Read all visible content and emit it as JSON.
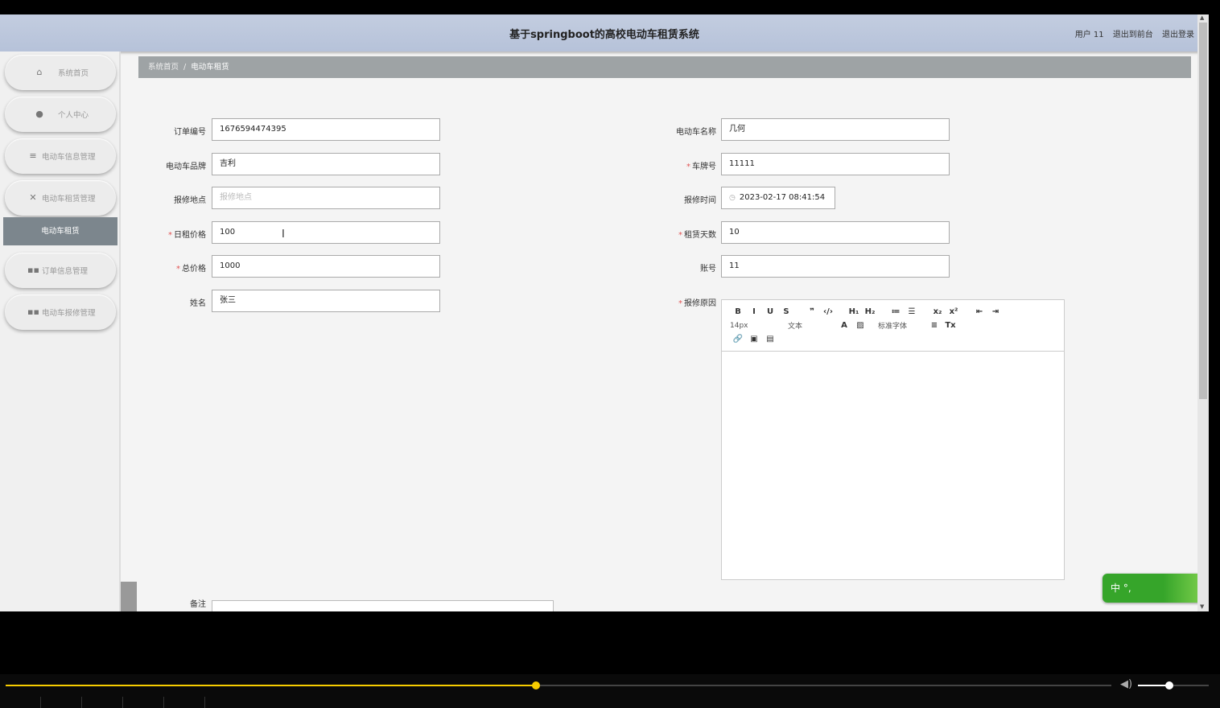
{
  "header": {
    "title": "基于springboot的高校电动车租赁系统",
    "user": "用户 11",
    "to_front": "退出到前台",
    "logout": "退出登录"
  },
  "sidebar": {
    "items": [
      {
        "label": "系统首页",
        "icon": "home-icon"
      },
      {
        "label": "个人中心",
        "icon": "user-icon"
      },
      {
        "label": "电动车信息管理",
        "icon": "list-icon"
      },
      {
        "label": "电动车租赁管理",
        "icon": "bike-icon"
      },
      {
        "label": "订单信息管理",
        "icon": "grid-icon"
      },
      {
        "label": "电动车报修管理",
        "icon": "grid-icon"
      }
    ],
    "active_sub": "电动车租赁"
  },
  "breadcrumb": {
    "home": "系统首页",
    "sep": "/",
    "current": "电动车租赁"
  },
  "form": {
    "order_no": {
      "label": "订单编号",
      "value": "1676594474395"
    },
    "brand": {
      "label": "电动车品牌",
      "value": "吉利"
    },
    "repair_place": {
      "label": "报修地点",
      "placeholder": "报修地点"
    },
    "daily_price": {
      "label": "日租价格",
      "value": "100",
      "required": "*"
    },
    "total_price": {
      "label": "总价格",
      "value": "1000",
      "required": "*"
    },
    "name": {
      "label": "姓名",
      "value": "张三"
    },
    "bike_name": {
      "label": "电动车名称",
      "value": "几何"
    },
    "plate": {
      "label": "车牌号",
      "value": "11111",
      "required": "*"
    },
    "repair_time": {
      "label": "报修时间",
      "value": "2023-02-17 08:41:54"
    },
    "rent_days": {
      "label": "租赁天数",
      "value": "10",
      "required": "*"
    },
    "account": {
      "label": "账号",
      "value": "11"
    },
    "repair_reason": {
      "label": "报修原因",
      "required": "*"
    },
    "remark": {
      "label": "备注"
    }
  },
  "editor": {
    "row1": [
      "B",
      "I",
      "U",
      "S",
      "❞",
      "‹/›",
      "H₁",
      "H₂",
      "≔",
      "☰",
      "x₂",
      "x²",
      "⇤",
      "⇥"
    ],
    "font_size": "14px",
    "text_style": "文本",
    "font_family": "标准字体",
    "row3": [
      "🔗",
      "▣",
      "▤"
    ]
  },
  "ime": {
    "label": "中"
  }
}
